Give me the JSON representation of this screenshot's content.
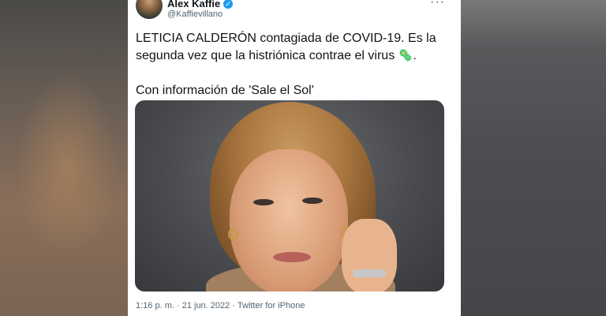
{
  "tweet": {
    "author_name": "Álex Kaffie",
    "author_handle": "@Kaffievillano",
    "more_menu": "···",
    "text_line1": "LETICIA CALDERÓN contagiada de COVID-19. Es la segunda vez que la histriónica contrae el virus",
    "virus_emoji": "🦠",
    "text_end": ".",
    "text_line2": "Con información de 'Sale el Sol'",
    "time": "1:16 p. m.",
    "separator": " · ",
    "date": "21 jun. 2022",
    "source": "Twitter for iPhone"
  },
  "colors": {
    "verified_badge": "#1d9bf0",
    "text_primary": "#0f1419",
    "text_secondary": "#536471"
  },
  "icons": {
    "verified": "verified-badge-icon",
    "more": "more-options-icon",
    "virus": "microbe-emoji"
  }
}
